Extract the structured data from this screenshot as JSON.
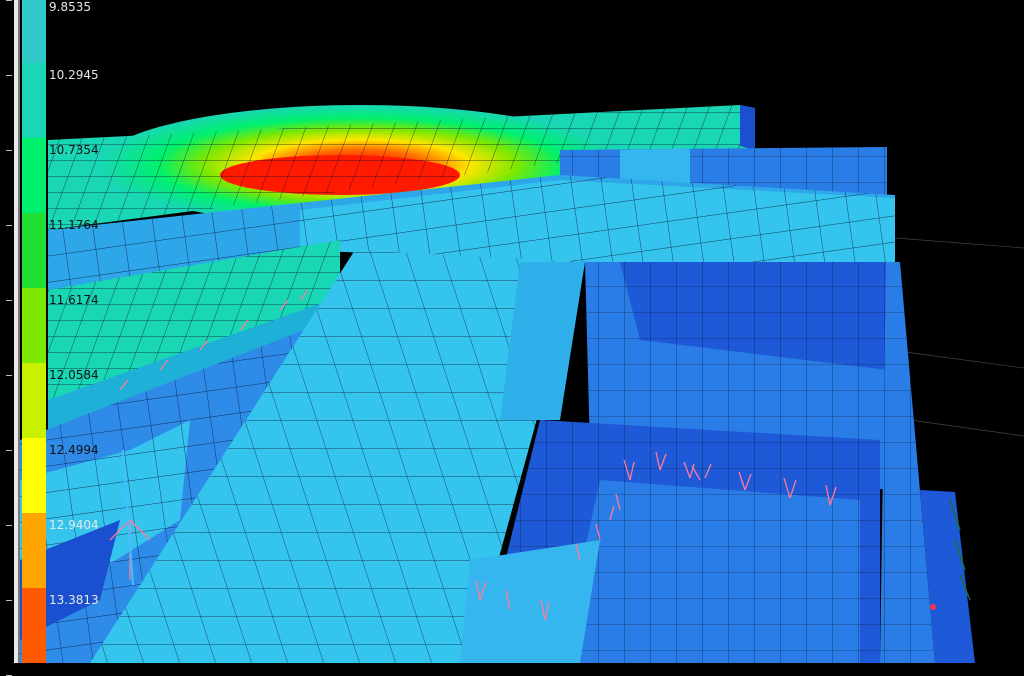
{
  "viewer": {
    "view": "3d-contour-plot"
  },
  "legend": {
    "entries": [
      {
        "label": "9.8535",
        "color": "#30c8c8"
      },
      {
        "label": "10.2945",
        "color": "#19d6b4"
      },
      {
        "label": "10.7354",
        "color": "#00f06e"
      },
      {
        "label": "11.1764",
        "color": "#22e033"
      },
      {
        "label": "11.6174",
        "color": "#7fe800"
      },
      {
        "label": "12.0584",
        "color": "#c8f000"
      },
      {
        "label": "12.4994",
        "color": "#ffff00"
      },
      {
        "label": "12.9404",
        "color": "#ffa500"
      },
      {
        "label": "13.3813",
        "color": "#ff5a00"
      },
      {
        "label": "",
        "color": "#ff0000"
      }
    ]
  },
  "colors": {
    "background": "#000000",
    "mesh_line": "#0a1030",
    "deep_blue": "#1e5ad8",
    "mid_blue": "#2e8be8",
    "light_blue": "#35c4ee",
    "support_marks": "#ff7a9a"
  }
}
